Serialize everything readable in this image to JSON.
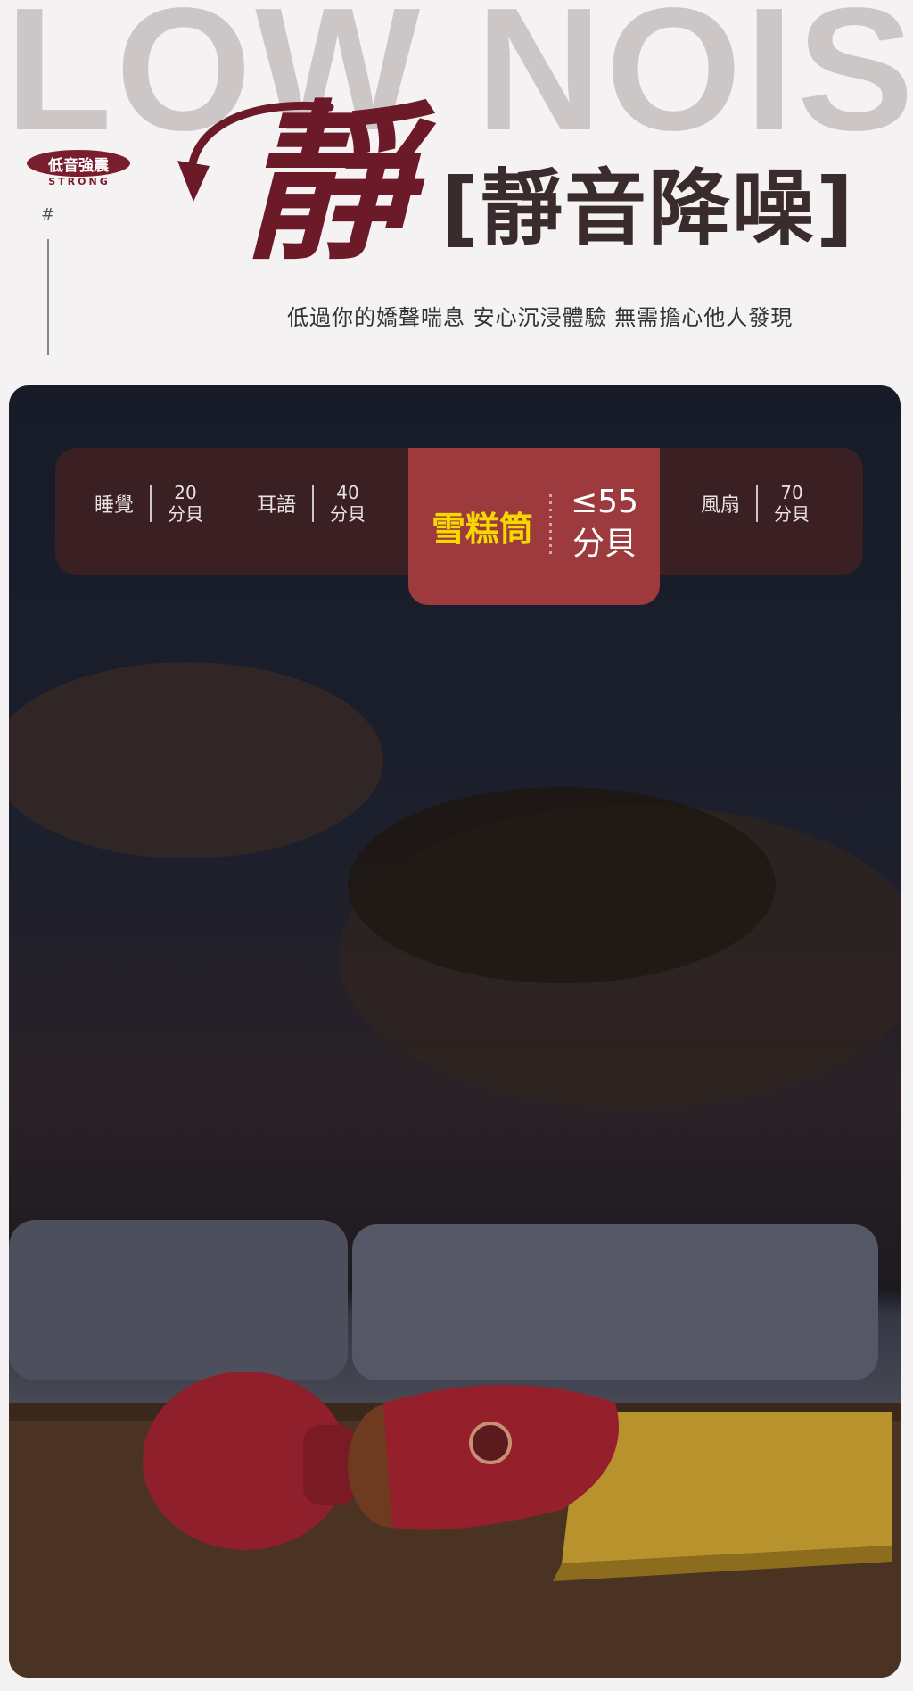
{
  "header": {
    "background_word": "LOW NOISE",
    "badge_text": "低音強震",
    "badge_subtext": "STRONG",
    "hash_mark": "#",
    "big_char": "靜",
    "title": "[靜音降噪]",
    "subtitle": "低過你的嬌聲喘息 安心沉浸體驗 無需擔心他人發現"
  },
  "noise_bar": {
    "items": [
      {
        "label": "睡覺",
        "value": "20",
        "unit": "分貝"
      },
      {
        "label": "耳語",
        "value": "40",
        "unit": "分貝"
      },
      {
        "label": "風扇",
        "value": "70",
        "unit": "分貝"
      }
    ],
    "highlight": {
      "label": "雪糕筒",
      "value": "≤55",
      "unit": "分貝"
    }
  },
  "colors": {
    "brand": "#6d1a28",
    "bar_bg": "#3b2023",
    "highlight_bg": "#9d3a3e",
    "highlight_text": "#f5d800"
  }
}
